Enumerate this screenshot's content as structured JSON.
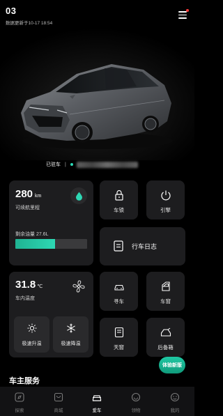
{
  "header": {
    "car_name": "03",
    "update_time": "数据更新于10-17 18:54"
  },
  "status": {
    "parked_label": "已驻车",
    "separator": "|"
  },
  "fuel": {
    "range_value": "280",
    "range_unit": "km",
    "range_label": "可续航里程",
    "remaining_label": "剩余油量 27.6L",
    "fuel_level_fraction": 0.55
  },
  "controls": {
    "car_lock": "车锁",
    "engine": "引擎",
    "trip_log": "行车日志",
    "find_car": "寻车",
    "windows": "车窗",
    "sunroof": "天窗",
    "trunk": "后备箱"
  },
  "climate": {
    "temp_value": "31.8",
    "temp_unit": "℃",
    "temp_label": "车内温度",
    "quick_heat": "极速升温",
    "quick_cool": "极速降温"
  },
  "section": {
    "owner_services": "车主服务"
  },
  "badge": {
    "new_version": "体验新版"
  },
  "tabs": [
    {
      "label": "探索",
      "icon": "compass-icon"
    },
    {
      "label": "商城",
      "icon": "store-icon"
    },
    {
      "label": "爱车",
      "icon": "car-icon"
    },
    {
      "label": "领物",
      "icon": "gift-icon"
    },
    {
      "label": "我的",
      "icon": "profile-icon"
    }
  ],
  "colors": {
    "accent": "#2ed8b4",
    "card_bg": "#1d1d1f",
    "background": "#000000",
    "notification": "#ff3b3b"
  }
}
